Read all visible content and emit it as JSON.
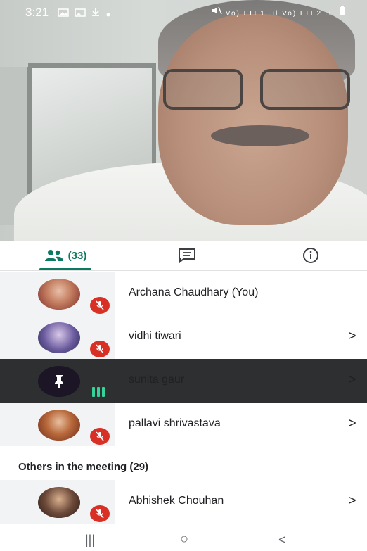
{
  "status_bar": {
    "time": "3:21",
    "left_icons": [
      "image-icon",
      "image-icon",
      "download-icon",
      "dot-icon"
    ],
    "right_icons": [
      "mute-icon",
      "signal-icon",
      "signal-icon",
      "battery-icon"
    ],
    "right_text": "Vo) LTE1 .ıl Vo) LTE2 .ıl"
  },
  "tabs": {
    "people_count": "(33)",
    "people_icon": "people-icon",
    "chat_icon": "chat-icon",
    "info_icon": "info-icon",
    "accent": "#0b7a61"
  },
  "participants": [
    {
      "name": "Archana Chaudhary (You)",
      "muted": true,
      "has_chevron": false,
      "avatar_color": "#b85a4a"
    },
    {
      "name": "vidhi tiwari",
      "muted": true,
      "has_chevron": true,
      "avatar_color": "#6a5a9e"
    },
    {
      "name": "sunita gaur",
      "muted": false,
      "has_chevron": true,
      "pinned": true,
      "speaking_icon": "audio-bars-icon"
    },
    {
      "name": "pallavi shrivastava",
      "muted": true,
      "has_chevron": true,
      "avatar_color": "#a8632a"
    }
  ],
  "others": {
    "label": "Others in the meeting (29)",
    "items": [
      {
        "name": "Abhishek Chouhan",
        "muted": true,
        "has_chevron": true,
        "avatar_color": "#6d4a3a"
      }
    ]
  },
  "chevron": ">",
  "nav": {
    "recents": "|||",
    "home": "○",
    "back": "<"
  }
}
